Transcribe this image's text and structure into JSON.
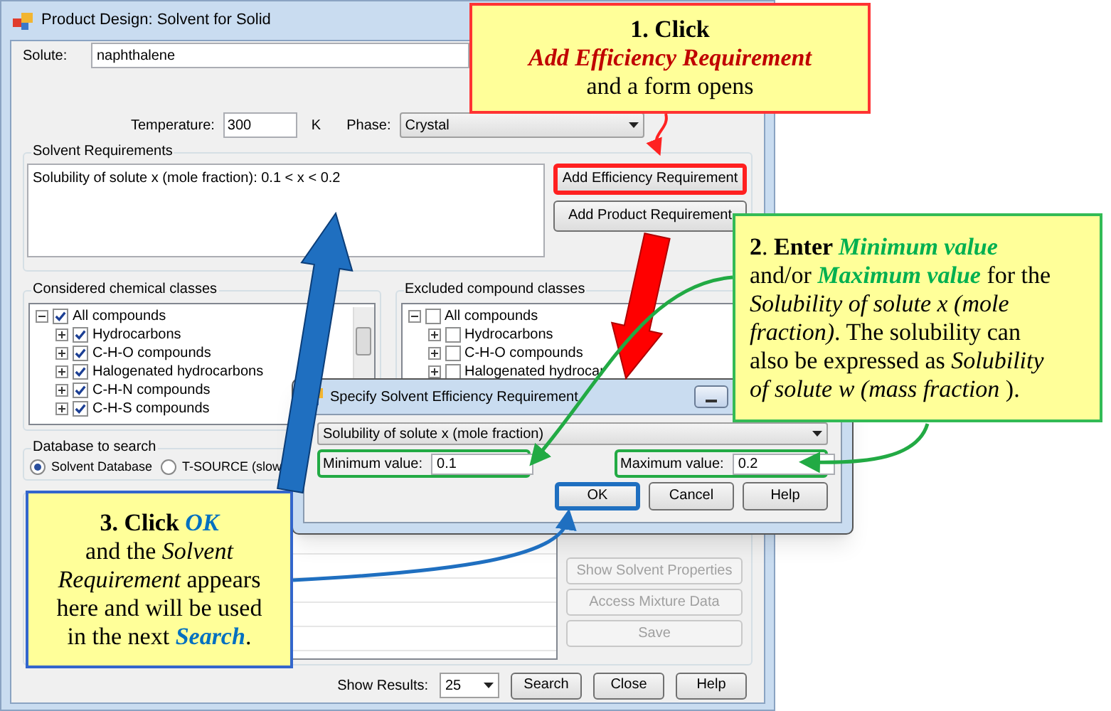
{
  "window": {
    "title": "Product Design: Solvent for Solid"
  },
  "solute": {
    "label": "Solute:",
    "value": "naphthalene"
  },
  "temperature": {
    "label": "Temperature:",
    "value": "300",
    "unit": "K"
  },
  "phase": {
    "label": "Phase:",
    "value": "Crystal"
  },
  "solvent_requirements": {
    "title": "Solvent Requirements",
    "items": [
      "Solubility of solute x (mole fraction): 0.1 < x < 0.2"
    ],
    "buttons": [
      {
        "label": "Add Efficiency Requirement",
        "highlighted": true
      },
      {
        "label": "Add Product Requirement",
        "highlighted": false
      }
    ]
  },
  "considered_classes": {
    "title": "Considered chemical classes",
    "tree": [
      {
        "label": "All compounds",
        "checked": true,
        "expanded": true,
        "children": [
          {
            "label": "Hydrocarbons",
            "checked": true,
            "expanded": false
          },
          {
            "label": "C-H-O compounds",
            "checked": true,
            "expanded": false
          },
          {
            "label": "Halogenated hydrocarbons",
            "checked": true,
            "expanded": false
          },
          {
            "label": "C-H-N compounds",
            "checked": true,
            "expanded": false
          },
          {
            "label": "C-H-S compounds",
            "checked": true,
            "expanded": false
          }
        ]
      }
    ]
  },
  "excluded_classes": {
    "title": "Excluded compound classes",
    "tree": [
      {
        "label": "All compounds",
        "checked": false,
        "expanded": true,
        "children": [
          {
            "label": "Hydrocarbons",
            "checked": false,
            "expanded": false
          },
          {
            "label": "C-H-O compounds",
            "checked": false,
            "expanded": false
          },
          {
            "label": "Halogenated hydrocar",
            "checked": false,
            "expanded": false
          }
        ]
      }
    ]
  },
  "database": {
    "title": "Database to search",
    "options": [
      {
        "label": "Solvent Database",
        "selected": true
      },
      {
        "label": "T-SOURCE (slow",
        "selected": false
      }
    ]
  },
  "results": {
    "buttons": [
      {
        "label": "Show Solvent Properties",
        "disabled": true
      },
      {
        "label": "Access Mixture Data",
        "disabled": true
      },
      {
        "label": "Save",
        "disabled": true
      }
    ]
  },
  "footer": {
    "show_results_label": "Show Results:",
    "show_results_value": "25",
    "buttons": [
      "Search",
      "Close",
      "Help"
    ]
  },
  "dialog": {
    "title": "Specify Solvent Efficiency Requirement",
    "property": "Solubility of solute x (mole fraction)",
    "minimum": {
      "label": "Minimum value:",
      "value": "0.1",
      "highlighted": true
    },
    "maximum": {
      "label": "Maximum value:",
      "value": "0.2",
      "highlighted": true
    },
    "buttons": [
      {
        "label": "OK",
        "highlighted": true
      },
      {
        "label": "Cancel",
        "highlighted": false
      },
      {
        "label": "Help",
        "highlighted": false
      }
    ]
  },
  "callouts": [
    {
      "lines": [
        [
          {
            "text": "1. Click",
            "kind": "bold"
          }
        ],
        [
          {
            "text": "Add Efficiency Requirement",
            "kind": "emphasis"
          }
        ],
        [
          {
            "text": "and a form opens",
            "kind": "plain"
          }
        ]
      ]
    },
    {
      "lines": [
        [
          {
            "text": "2",
            "kind": "bold"
          },
          {
            "text": ". ",
            "kind": "plain"
          },
          {
            "text": "Enter ",
            "kind": "bold"
          },
          {
            "text": "Minimum value",
            "kind": "emphasis"
          }
        ],
        [
          {
            "text": "and/or ",
            "kind": "plain"
          },
          {
            "text": "Maximum value",
            "kind": "emphasis"
          },
          {
            "text": " for the",
            "kind": "plain"
          }
        ],
        [
          {
            "text": "Solubility of solute x (mole",
            "kind": "italic"
          }
        ],
        [
          {
            "text": "fraction)",
            "kind": "italic"
          },
          {
            "text": ". The solubility can",
            "kind": "plain"
          }
        ],
        [
          {
            "text": "also be expressed as ",
            "kind": "plain"
          },
          {
            "text": "Solubility",
            "kind": "italic"
          }
        ],
        [
          {
            "text": "of solute w (mass fraction ",
            "kind": "italic"
          },
          {
            "text": ").",
            "kind": "plain"
          }
        ]
      ]
    },
    {
      "lines": [
        [
          {
            "text": "3. Click ",
            "kind": "bold"
          },
          {
            "text": "OK",
            "kind": "emphasis"
          }
        ],
        [
          {
            "text": "and the ",
            "kind": "plain"
          },
          {
            "text": "Solvent",
            "kind": "italic"
          }
        ],
        [
          {
            "text": "Requirement",
            "kind": "italic"
          },
          {
            "text": " appears",
            "kind": "plain"
          }
        ],
        [
          {
            "text": "here and will be used",
            "kind": "plain"
          }
        ],
        [
          {
            "text": "in the next ",
            "kind": "plain"
          },
          {
            "text": "Search",
            "kind": "emphasis"
          },
          {
            "text": ".",
            "kind": "plain"
          }
        ]
      ]
    }
  ]
}
